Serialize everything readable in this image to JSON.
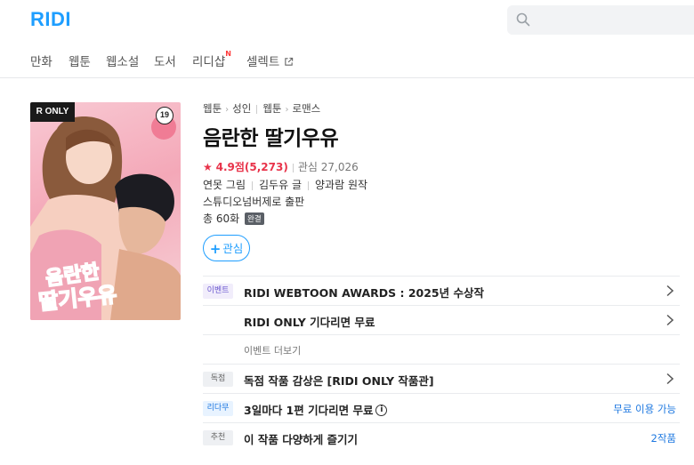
{
  "header": {
    "logo": "RIDI",
    "search_placeholder": ""
  },
  "nav": {
    "items": [
      {
        "label": "만화"
      },
      {
        "label": "웹툰"
      },
      {
        "label": "웹소설"
      },
      {
        "label": "도서"
      },
      {
        "label": "리디샵",
        "badge": "N"
      },
      {
        "label": "셀렉트"
      }
    ]
  },
  "cover": {
    "badge": "R ONLY",
    "age": "19"
  },
  "work": {
    "breadcrumb": [
      "웹툰",
      "성인",
      "웹툰",
      "로맨스"
    ],
    "title": "음란한 딸기우유",
    "rating_star": "★",
    "rating_score": "4.9점",
    "rating_count": "(5,273)",
    "favorites": "관심 27,026",
    "authors": [
      {
        "name": "연못",
        "role": "그림"
      },
      {
        "name": "김두유",
        "role": "글"
      },
      {
        "name": "양과람",
        "role": "원작"
      }
    ],
    "publisher": "스튜디오넘버제로 출판",
    "episodes": "총 60화",
    "status": "완결",
    "favorite_button": "관심"
  },
  "rows": [
    {
      "tag": "이벤트",
      "text": "RIDI WEBTOON AWARDS : 2025년 수상작",
      "chevron": true
    },
    {
      "tag": "",
      "text": "RIDI ONLY 기다리면 무료",
      "chevron": true
    },
    {
      "tag": "",
      "sub": "이벤트 더보기"
    },
    {
      "tag": "독점",
      "text": "독점 작품 감상은 [RIDI ONLY 작품관]",
      "chevron": true
    },
    {
      "tag": "리다무",
      "text": "3일마다 1편 기다리면 무료",
      "info": "i",
      "right": "무료 이용 가능"
    },
    {
      "tag": "추천",
      "text": "이 작품 다양하게 즐기기",
      "right": "2작품"
    }
  ],
  "colors": {
    "brand": "#1e9eff",
    "rating": "#e8334a",
    "link": "#1e78e0"
  }
}
